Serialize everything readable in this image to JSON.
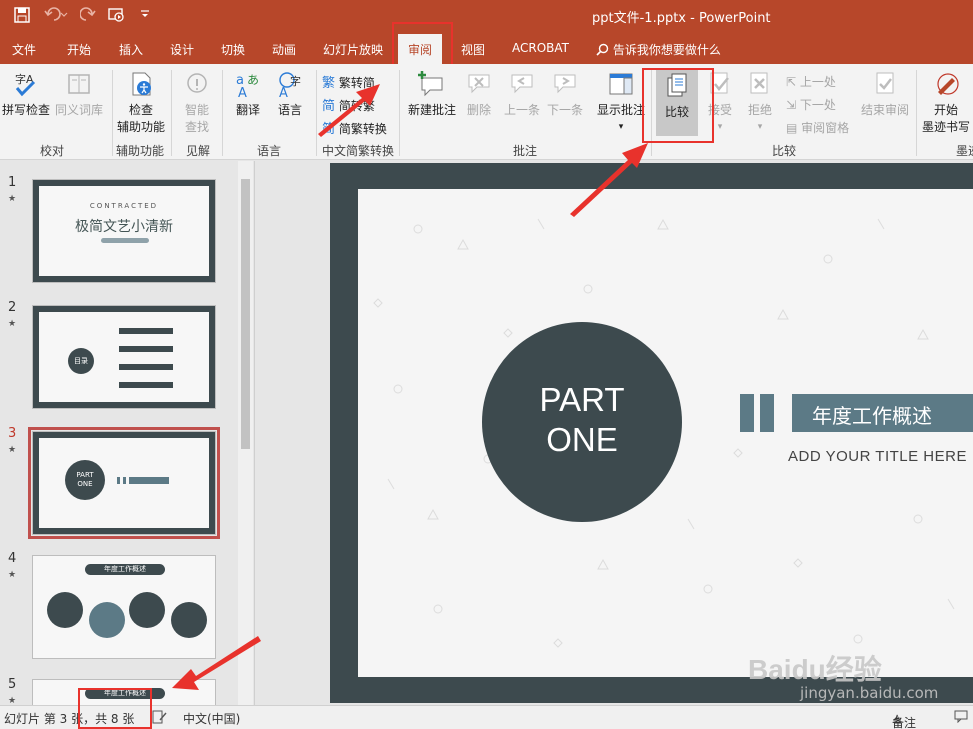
{
  "titlebar": {
    "title": "ppt文件-1.pptx  -  PowerPoint",
    "icons": [
      "save-icon",
      "undo-icon",
      "redo-icon",
      "start-slideshow-icon",
      "customize-qa-icon"
    ]
  },
  "tabs": [
    {
      "label": "文件"
    },
    {
      "label": "开始"
    },
    {
      "label": "插入"
    },
    {
      "label": "设计"
    },
    {
      "label": "切换"
    },
    {
      "label": "动画"
    },
    {
      "label": "幻灯片放映"
    },
    {
      "label": "审阅"
    },
    {
      "label": "视图"
    },
    {
      "label": "ACROBAT"
    }
  ],
  "search_label": "告诉我你想要做什么",
  "ribbon": {
    "spell": "拼写检查",
    "thesaurus": "同义词库",
    "accessibility": "检查\n辅助功能",
    "accessibility_l1": "检查",
    "accessibility_l2": "辅助功能",
    "smart_lookup_l1": "智能",
    "smart_lookup_l2": "查找",
    "translate": "翻译",
    "language": "语言",
    "to_simplified": "繁转简",
    "to_traditional": "简转繁",
    "convert": "简繁转换",
    "new_comment": "新建批注",
    "delete": "删除",
    "previous": "上一条",
    "next": "下一条",
    "show_comments": "显示批注",
    "compare": "比较",
    "accept": "接受",
    "reject": "拒绝",
    "prev_change": "上一处",
    "next_change": "下一处",
    "review_pane": "审阅窗格",
    "end_review": "结束审阅",
    "ink_l1": "开始",
    "ink_l2": "墨迹书写",
    "groups": {
      "proofing": "校对",
      "accessibility": "辅助功能",
      "insights": "见解",
      "language": "语言",
      "chinese_conversion": "中文简繁转换",
      "comments": "批注",
      "compare": "比较",
      "ink": "墨迹"
    }
  },
  "slides": [
    {
      "number": "1",
      "star": "★",
      "title_small": "CONTRACTED",
      "title": "极简文艺小清新"
    },
    {
      "number": "2",
      "star": "★",
      "label": "目录"
    },
    {
      "number": "3",
      "star": "★",
      "part_l1": "PART",
      "part_l2": "ONE"
    },
    {
      "number": "4",
      "star": "★",
      "heading": "年度工作概述"
    },
    {
      "number": "5",
      "star": "★",
      "heading": "年度工作概述"
    }
  ],
  "current_slide": {
    "part_l1": "PART",
    "part_l2": "ONE",
    "title": "年度工作概述",
    "subtitle": "ADD YOUR TITLE  HERE"
  },
  "status": {
    "slide_info": "幻灯片 第 3 张，共 8 张",
    "language": "中文(中国)",
    "notes": "备注"
  },
  "watermark": {
    "brand": "Baidu经验",
    "url": "jingyan.baidu.com"
  },
  "colors": {
    "brand": "#b7472a",
    "highlight_box": "#e8322c",
    "slide_dark": "#3d4a4e",
    "slide_accent": "#5c7a86",
    "selected_thumb": "#c0504d"
  }
}
